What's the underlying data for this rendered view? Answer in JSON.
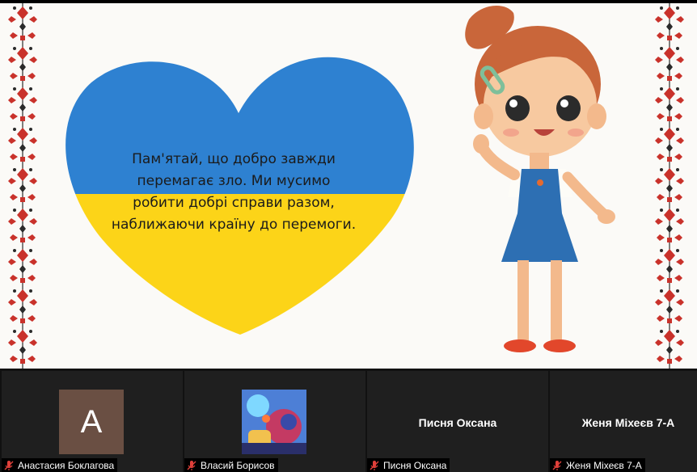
{
  "slide": {
    "message_lines": [
      "Пам'ятай, що добро завжди",
      "перемагає зло. Ми мусимо",
      "робити добрі справи разом,",
      "наближаючи країну до перемоги."
    ],
    "colors": {
      "heart_top": "#2e81d1",
      "heart_bottom": "#fcd418",
      "background": "#fbfaf7",
      "embroidery_red": "#c9322b",
      "embroidery_dark": "#2a2a2a"
    }
  },
  "participants": [
    {
      "name": "Анастасия Боклагова",
      "avatar_type": "letter",
      "avatar_letter": "A",
      "avatar_color": "#6a4f43",
      "mic": "muted"
    },
    {
      "name": "Власий Борисов",
      "avatar_type": "image",
      "avatar_image_label": "game-art-avatar",
      "mic": "muted"
    },
    {
      "name": "Писня Оксана",
      "avatar_type": "name",
      "center_name": "Писня Оксана",
      "mic": "muted"
    },
    {
      "name": "Женя Міхеєв 7-А",
      "avatar_type": "name",
      "center_name": "Женя Міхеєв 7-А",
      "mic": "muted"
    }
  ],
  "icons": {
    "muted_mic": "microphone-muted-icon"
  }
}
